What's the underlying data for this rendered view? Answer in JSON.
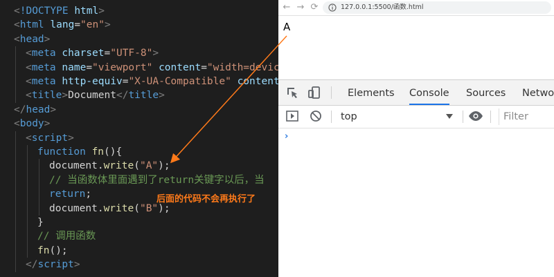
{
  "editor": {
    "lines": [
      {
        "indent": 0,
        "tokens": [
          [
            "punct",
            "<"
          ],
          [
            "tag",
            "!DOCTYPE "
          ],
          [
            "attr",
            "html"
          ],
          [
            "punct",
            ">"
          ]
        ]
      },
      {
        "indent": 0,
        "tokens": [
          [
            "punct",
            "<"
          ],
          [
            "tag",
            "html "
          ],
          [
            "attr",
            "lang"
          ],
          [
            "text",
            "="
          ],
          [
            "str",
            "\"en\""
          ],
          [
            "punct",
            ">"
          ]
        ]
      },
      {
        "indent": 0,
        "tokens": [
          [
            "punct",
            "<"
          ],
          [
            "tag",
            "head"
          ],
          [
            "punct",
            ">"
          ]
        ]
      },
      {
        "indent": 1,
        "tokens": [
          [
            "punct",
            "<"
          ],
          [
            "tag",
            "meta "
          ],
          [
            "attr",
            "charset"
          ],
          [
            "text",
            "="
          ],
          [
            "str",
            "\"UTF-8\""
          ],
          [
            "punct",
            ">"
          ]
        ]
      },
      {
        "indent": 1,
        "tokens": [
          [
            "punct",
            "<"
          ],
          [
            "tag",
            "meta "
          ],
          [
            "attr",
            "name"
          ],
          [
            "text",
            "="
          ],
          [
            "str",
            "\"viewport\" "
          ],
          [
            "attr",
            "content"
          ],
          [
            "text",
            "="
          ],
          [
            "str",
            "\"width=device-"
          ]
        ]
      },
      {
        "indent": 1,
        "tokens": [
          [
            "punct",
            "<"
          ],
          [
            "tag",
            "meta "
          ],
          [
            "attr",
            "http-equiv"
          ],
          [
            "text",
            "="
          ],
          [
            "str",
            "\"X-UA-Compatible\" "
          ],
          [
            "attr",
            "content"
          ],
          [
            "text",
            "="
          ],
          [
            "str",
            "\""
          ]
        ]
      },
      {
        "indent": 1,
        "tokens": [
          [
            "punct",
            "<"
          ],
          [
            "tag",
            "title"
          ],
          [
            "punct",
            ">"
          ],
          [
            "text",
            "Document"
          ],
          [
            "punct",
            "</"
          ],
          [
            "tag",
            "title"
          ],
          [
            "punct",
            ">"
          ]
        ]
      },
      {
        "indent": 0,
        "tokens": [
          [
            "punct",
            "</"
          ],
          [
            "tag",
            "head"
          ],
          [
            "punct",
            ">"
          ]
        ]
      },
      {
        "indent": 0,
        "tokens": [
          [
            "punct",
            "<"
          ],
          [
            "tag",
            "body"
          ],
          [
            "punct",
            ">"
          ]
        ]
      },
      {
        "indent": 1,
        "tokens": [
          [
            "punct",
            "<"
          ],
          [
            "tag",
            "script"
          ],
          [
            "punct",
            ">"
          ]
        ]
      },
      {
        "indent": 2,
        "tokens": [
          [
            "kw",
            "function "
          ],
          [
            "fn",
            "fn"
          ],
          [
            "text",
            "(){"
          ]
        ]
      },
      {
        "indent": 3,
        "tokens": [
          [
            "text",
            "document."
          ],
          [
            "fn",
            "write"
          ],
          [
            "text",
            "("
          ],
          [
            "str",
            "\"A\""
          ],
          [
            "text",
            ");"
          ]
        ]
      },
      {
        "indent": 3,
        "tokens": [
          [
            "comment",
            "// 当函数体里面遇到了return关键字以后，当"
          ]
        ]
      },
      {
        "indent": 3,
        "tokens": [
          [
            "kw",
            "return"
          ],
          [
            "text",
            ";"
          ]
        ]
      },
      {
        "indent": 3,
        "tokens": [
          [
            "text",
            "document."
          ],
          [
            "fn",
            "write"
          ],
          [
            "text",
            "("
          ],
          [
            "str",
            "\"B\""
          ],
          [
            "text",
            ");"
          ]
        ]
      },
      {
        "indent": 2,
        "tokens": [
          [
            "text",
            "}"
          ]
        ]
      },
      {
        "indent": 2,
        "tokens": [
          [
            "comment",
            "// 调用函数"
          ]
        ]
      },
      {
        "indent": 2,
        "tokens": [
          [
            "fn",
            "fn"
          ],
          [
            "text",
            "();"
          ]
        ]
      },
      {
        "indent": 1,
        "tokens": [
          [
            "punct",
            "</"
          ],
          [
            "tag",
            "script"
          ],
          [
            "punct",
            ">"
          ]
        ]
      }
    ],
    "annotation": "后面的代码不会再执行了",
    "colors": {
      "annotation": "#ff7a1a",
      "arrow": "#ff7a1a"
    }
  },
  "browser": {
    "nav": {
      "back_icon": "back-arrow-icon",
      "forward_icon": "forward-arrow-icon",
      "reload_icon": "reload-icon"
    },
    "url": "127.0.0.1:5500/函数.html",
    "page_text": "A",
    "devtools": {
      "tabs": [
        "Elements",
        "Console",
        "Sources",
        "Network"
      ],
      "active_tab": "Console",
      "context": "top",
      "filter_placeholder": "Filter",
      "prompt": "›"
    }
  }
}
